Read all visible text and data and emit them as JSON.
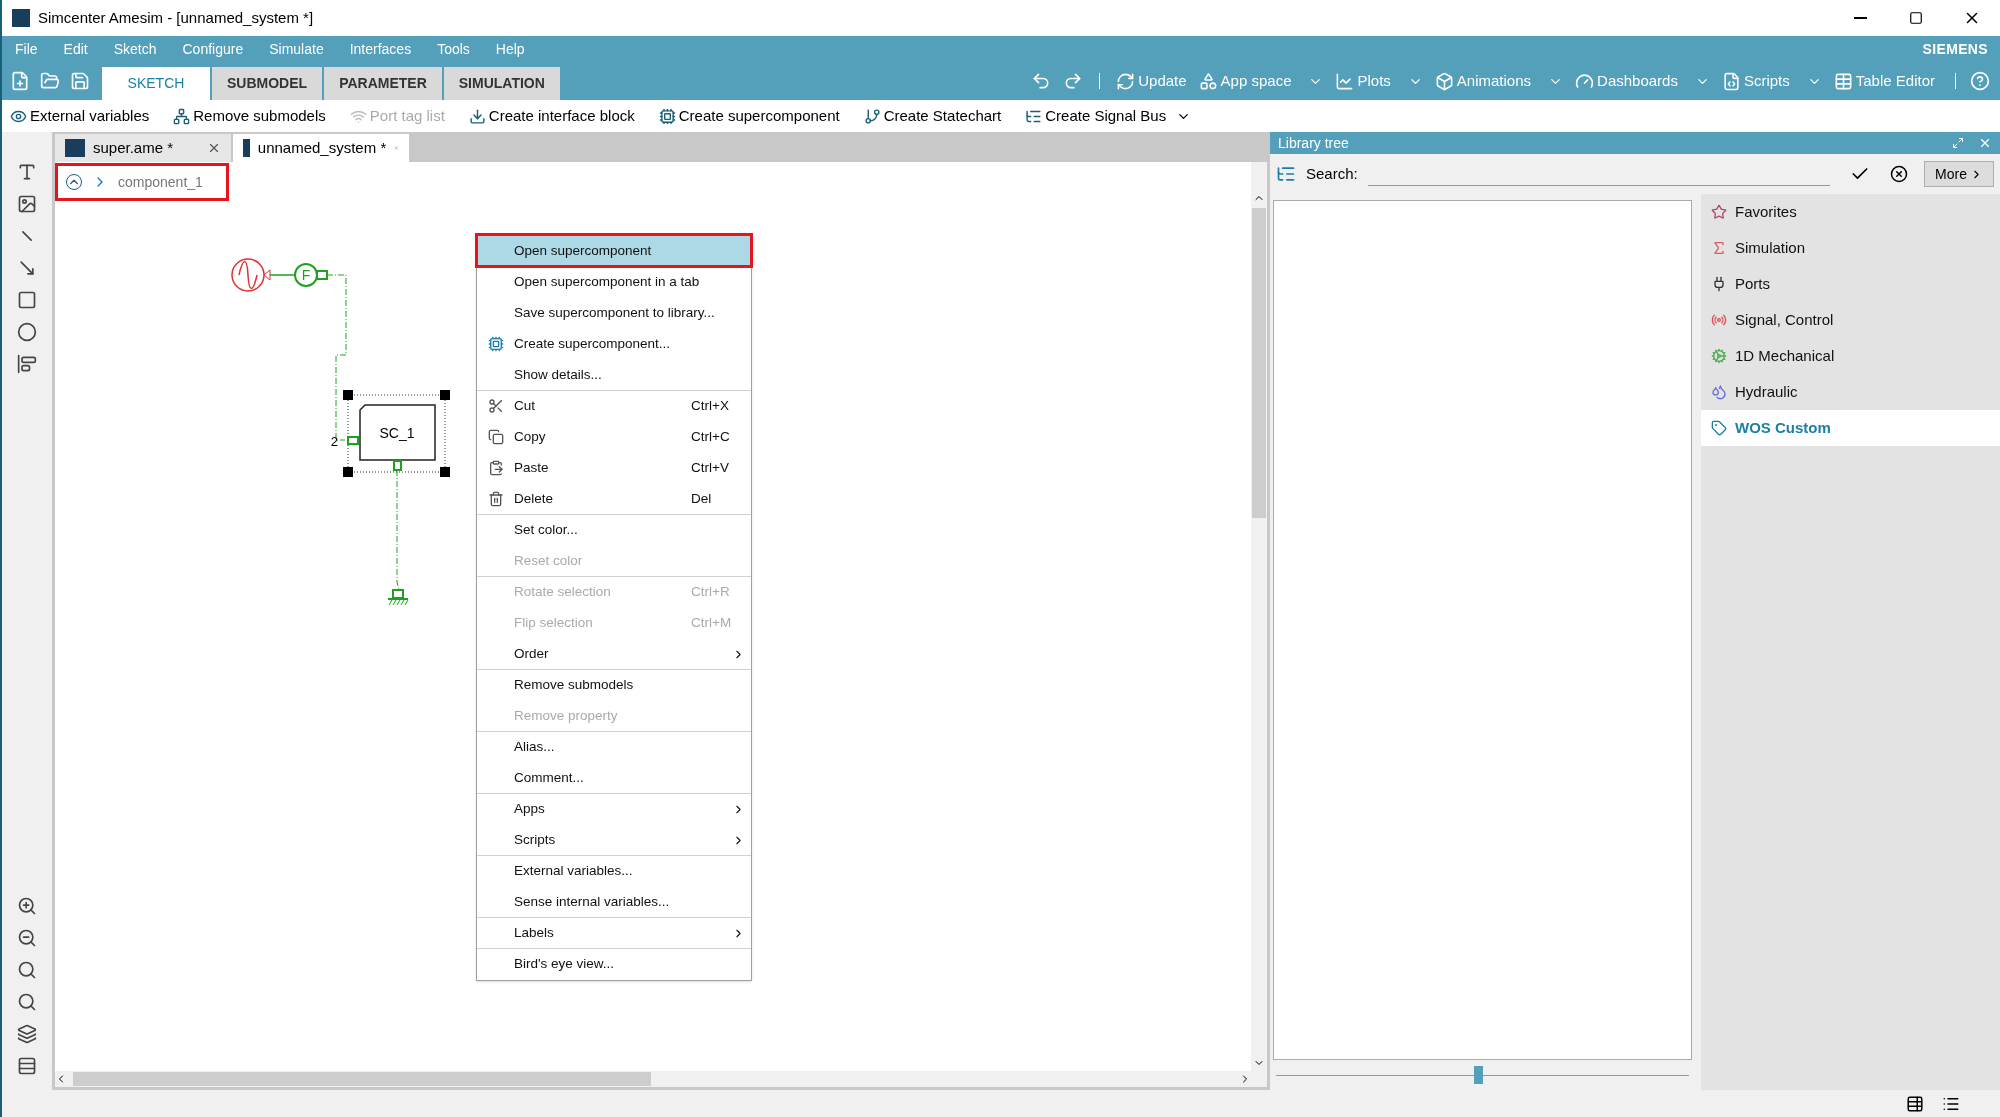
{
  "window": {
    "title": "Simcenter Amesim - [unnamed_system *]"
  },
  "menu_bar": [
    "File",
    "Edit",
    "Sketch",
    "Configure",
    "Simulate",
    "Interfaces",
    "Tools",
    "Help"
  ],
  "brand": "SIEMENS",
  "ribbon_tabs": [
    {
      "label": "SKETCH",
      "selected": true
    },
    {
      "label": "SUBMODEL",
      "selected": false
    },
    {
      "label": "PARAMETER",
      "selected": false
    },
    {
      "label": "SIMULATION",
      "selected": false
    }
  ],
  "ribbon_actions": [
    {
      "label": "Update",
      "dropdown": false
    },
    {
      "label": "App space",
      "dropdown": true
    },
    {
      "label": "Plots",
      "dropdown": true
    },
    {
      "label": "Animations",
      "dropdown": true
    },
    {
      "label": "Dashboards",
      "dropdown": true
    },
    {
      "label": "Scripts",
      "dropdown": true
    },
    {
      "label": "Table Editor",
      "dropdown": false
    }
  ],
  "toolbar": [
    {
      "label": "External variables",
      "disabled": false
    },
    {
      "label": "Remove submodels",
      "disabled": false
    },
    {
      "label": "Port tag list",
      "disabled": true
    },
    {
      "label": "Create interface block",
      "disabled": false
    },
    {
      "label": "Create supercomponent",
      "disabled": false
    },
    {
      "label": "Create Statechart",
      "disabled": false
    },
    {
      "label": "Create Signal Bus",
      "disabled": false
    }
  ],
  "document_tabs": [
    {
      "label": "super.ame *",
      "selected": false
    },
    {
      "label": "unnamed_system *",
      "selected": true
    }
  ],
  "breadcrumb": {
    "item": "component_1"
  },
  "diagram": {
    "source_label": "F",
    "block_label": "SC_1",
    "port_number": "2"
  },
  "context_menu": {
    "items": [
      {
        "label": "Open supercomponent",
        "disabled": false,
        "selected": true,
        "submenu": false,
        "separator_before": false
      },
      {
        "label": "Open supercomponent in a tab",
        "disabled": false,
        "selected": false,
        "submenu": false,
        "separator_before": false
      },
      {
        "label": "Save supercomponent to library...",
        "disabled": false,
        "selected": false,
        "submenu": false,
        "separator_before": false
      },
      {
        "label": "Create supercomponent...",
        "disabled": false,
        "selected": false,
        "submenu": false,
        "separator_before": false
      },
      {
        "label": "Show details...",
        "disabled": false,
        "selected": false,
        "submenu": false,
        "separator_before": false
      },
      {
        "label": "Cut",
        "shortcut": "Ctrl+X",
        "disabled": false,
        "selected": false,
        "submenu": false,
        "separator_before": true
      },
      {
        "label": "Copy",
        "shortcut": "Ctrl+C",
        "disabled": false,
        "selected": false,
        "submenu": false,
        "separator_before": false
      },
      {
        "label": "Paste",
        "shortcut": "Ctrl+V",
        "disabled": false,
        "selected": false,
        "submenu": false,
        "separator_before": false
      },
      {
        "label": "Delete",
        "shortcut": "Del",
        "disabled": false,
        "selected": false,
        "submenu": false,
        "separator_before": false
      },
      {
        "label": "Set color...",
        "disabled": false,
        "selected": false,
        "submenu": false,
        "separator_before": true
      },
      {
        "label": "Reset color",
        "disabled": true,
        "selected": false,
        "submenu": false,
        "separator_before": false
      },
      {
        "label": "Rotate selection",
        "shortcut": "Ctrl+R",
        "disabled": true,
        "selected": false,
        "submenu": false,
        "separator_before": true
      },
      {
        "label": "Flip selection",
        "shortcut": "Ctrl+M",
        "disabled": true,
        "selected": false,
        "submenu": false,
        "separator_before": false
      },
      {
        "label": "Order",
        "disabled": false,
        "selected": false,
        "submenu": true,
        "separator_before": false
      },
      {
        "label": "Remove submodels",
        "disabled": false,
        "selected": false,
        "submenu": false,
        "separator_before": true
      },
      {
        "label": "Remove property",
        "disabled": true,
        "selected": false,
        "submenu": false,
        "separator_before": false
      },
      {
        "label": "Alias...",
        "disabled": false,
        "selected": false,
        "submenu": false,
        "separator_before": true
      },
      {
        "label": "Comment...",
        "disabled": false,
        "selected": false,
        "submenu": false,
        "separator_before": false
      },
      {
        "label": "Apps",
        "disabled": false,
        "selected": false,
        "submenu": true,
        "separator_before": true
      },
      {
        "label": "Scripts",
        "disabled": false,
        "selected": false,
        "submenu": true,
        "separator_before": false
      },
      {
        "label": "External variables...",
        "disabled": false,
        "selected": false,
        "submenu": false,
        "separator_before": true
      },
      {
        "label": "Sense internal variables...",
        "disabled": false,
        "selected": false,
        "submenu": false,
        "separator_before": false
      },
      {
        "label": "Labels",
        "disabled": false,
        "selected": false,
        "submenu": true,
        "separator_before": true
      },
      {
        "label": "Bird's eye view...",
        "disabled": false,
        "selected": false,
        "submenu": false,
        "separator_before": true
      }
    ]
  },
  "library_tree": {
    "title": "Library tree",
    "search_label": "Search:",
    "more_button": "More",
    "categories": [
      {
        "label": "Favorites",
        "selected": false
      },
      {
        "label": "Simulation",
        "selected": false
      },
      {
        "label": "Ports",
        "selected": false
      },
      {
        "label": "Signal, Control",
        "selected": false
      },
      {
        "label": "1D Mechanical",
        "selected": false
      },
      {
        "label": "Hydraulic",
        "selected": false
      },
      {
        "label": "WOS Custom",
        "selected": true
      }
    ],
    "zoom_slider": {
      "level": 0.49
    }
  }
}
